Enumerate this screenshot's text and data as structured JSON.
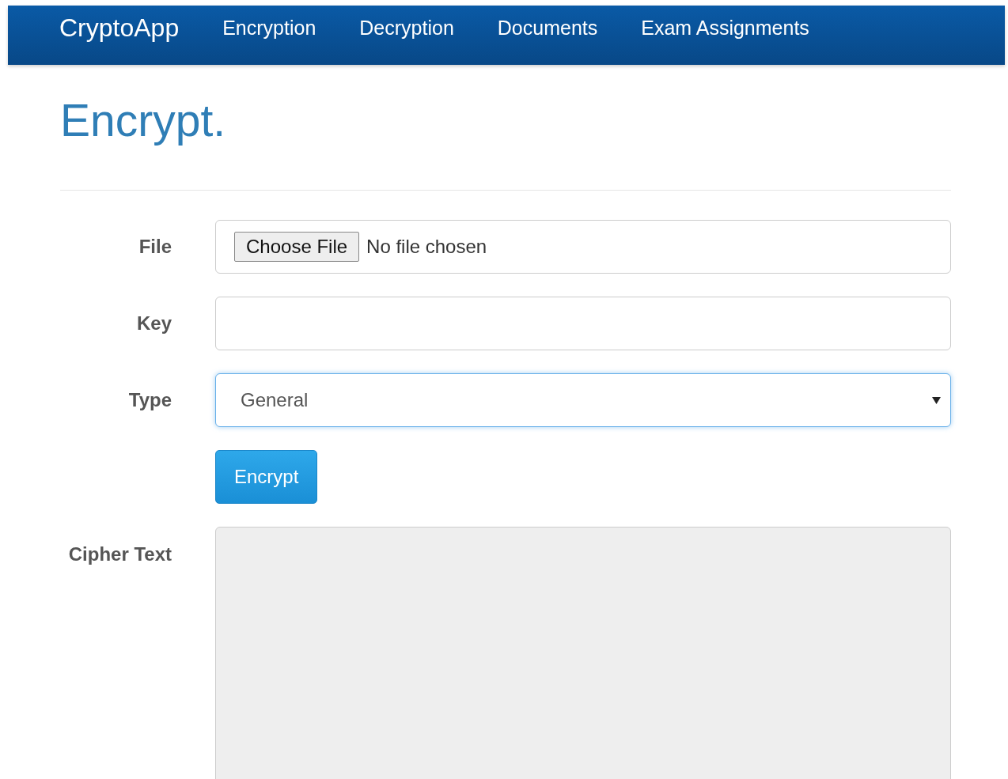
{
  "navbar": {
    "brand": "CryptoApp",
    "links": [
      {
        "label": "Encryption"
      },
      {
        "label": "Decryption"
      },
      {
        "label": "Documents"
      },
      {
        "label": "Exam Assignments"
      }
    ]
  },
  "page": {
    "title": "Encrypt."
  },
  "form": {
    "fields": [
      {
        "kind": "file",
        "label": "File",
        "button": "Choose File",
        "status": "No file chosen"
      },
      {
        "kind": "text",
        "label": "Key"
      },
      {
        "kind": "select",
        "label": "Type",
        "value": "General",
        "focused": true
      },
      {
        "kind": "submit",
        "label": "Encrypt"
      },
      {
        "kind": "textarea",
        "label": "Cipher Text",
        "disabled": true
      }
    ]
  }
}
